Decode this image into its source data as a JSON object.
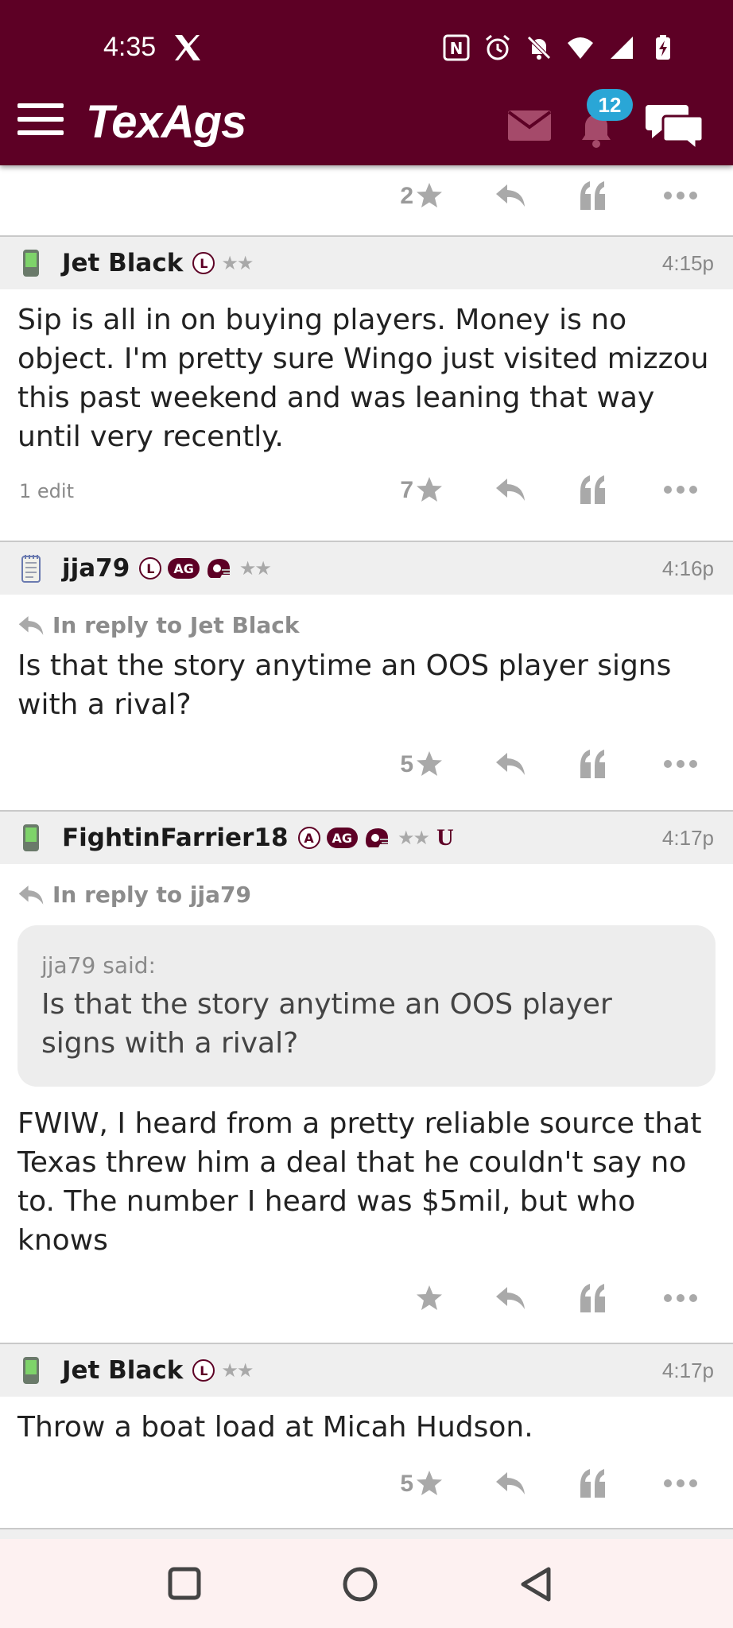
{
  "status_bar": {
    "time": "4:35"
  },
  "app_bar": {
    "brand": "TexAgs",
    "notification_count": "12"
  },
  "posts": [
    {
      "top_count": "2"
    },
    {
      "user": "Jet Black",
      "role_badge": "L",
      "stars": "★★",
      "time": "4:15p",
      "text": "Sip is all in on buying players. Money is no object. I'm pretty sure Wingo just visited mizzou this past weekend and was leaning that way until very recently.",
      "edit_note": "1 edit",
      "star_count": "7"
    },
    {
      "user": "jja79",
      "role_badge": "L",
      "ag_badge": "AG",
      "stars": "★★",
      "time": "4:16p",
      "reply_to": "In reply to Jet Black",
      "text": "Is that the story anytime an OOS player signs with a rival?",
      "star_count": "5"
    },
    {
      "user": "FightinFarrier18",
      "role_badge": "A",
      "ag_badge": "AG",
      "stars": "★★",
      "u_logo": "U",
      "time": "4:17p",
      "reply_to": "In reply to jja79",
      "quote_author": "jja79 said:",
      "quote_text": "Is that the story anytime an OOS player signs with a rival?",
      "text": "FWIW, I heard from a pretty reliable source that Texas threw him a deal that he couldn't say no to. The number I heard was $5mil, but who knows",
      "star_count": ""
    },
    {
      "user": "Jet Black",
      "role_badge": "L",
      "stars": "★★",
      "time": "4:17p",
      "text": "Throw a boat load at Micah Hudson.",
      "star_count": "5"
    }
  ],
  "colors": {
    "maroon": "#5d0025",
    "badge_blue": "#2aa6d6",
    "icon_gray": "#a9a9a9"
  }
}
